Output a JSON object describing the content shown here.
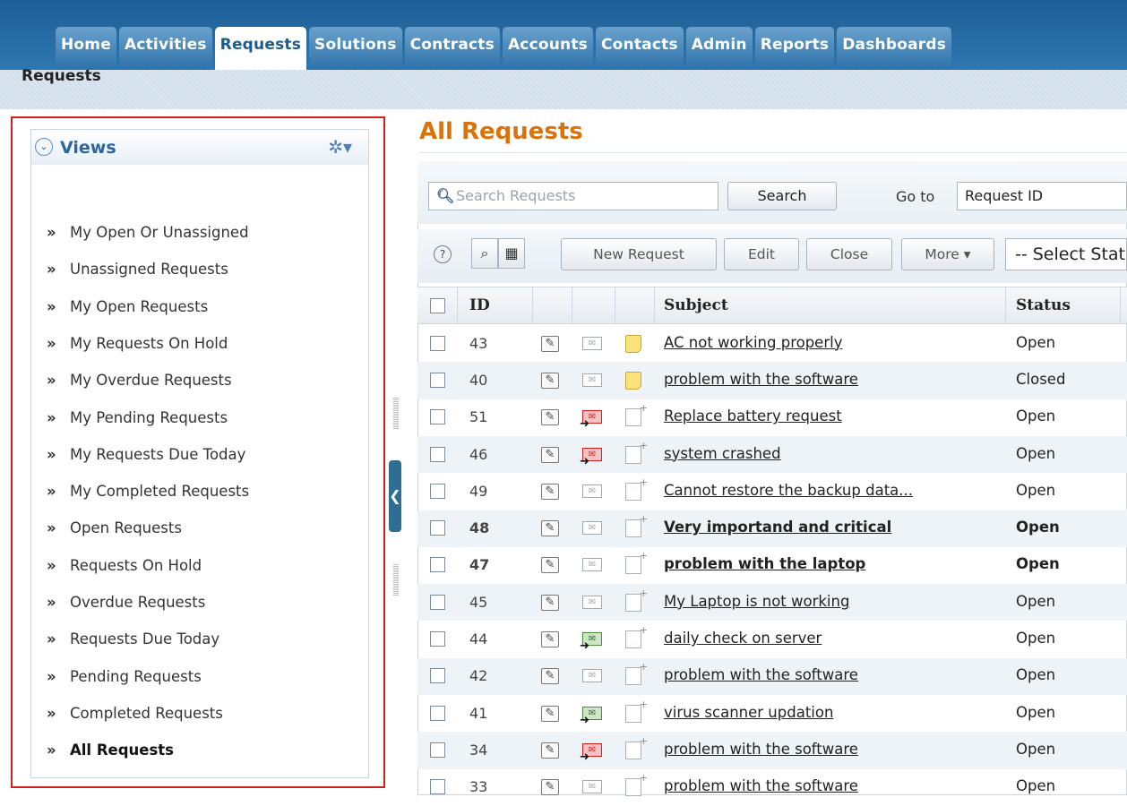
{
  "tabs": [
    {
      "label": "Home"
    },
    {
      "label": "Activities"
    },
    {
      "label": "Requests"
    },
    {
      "label": "Solutions"
    },
    {
      "label": "Contracts"
    },
    {
      "label": "Accounts"
    },
    {
      "label": "Contacts"
    },
    {
      "label": "Admin"
    },
    {
      "label": "Reports"
    },
    {
      "label": "Dashboards"
    }
  ],
  "active_tab": "Requests",
  "sidebar": {
    "header": "Views",
    "section": "Requests",
    "items": [
      {
        "label": "My Open Or Unassigned"
      },
      {
        "label": "Unassigned Requests"
      },
      {
        "label": "My Open Requests"
      },
      {
        "label": "My Requests On Hold"
      },
      {
        "label": "My Overdue Requests"
      },
      {
        "label": "My Pending Requests"
      },
      {
        "label": "My Requests Due Today"
      },
      {
        "label": "My Completed Requests"
      },
      {
        "label": "Open Requests"
      },
      {
        "label": "Requests On Hold"
      },
      {
        "label": "Overdue Requests"
      },
      {
        "label": "Requests Due Today"
      },
      {
        "label": "Pending Requests"
      },
      {
        "label": "Completed Requests"
      },
      {
        "label": "All Requests"
      }
    ],
    "bullet": "»"
  },
  "main": {
    "title": "All Requests",
    "search": {
      "placeholder": "Search Requests",
      "button": "Search",
      "goto_label": "Go to",
      "goto_value": "Request ID"
    },
    "toolbar": {
      "help": "?",
      "new_request": "New Request",
      "edit": "Edit",
      "close": "Close",
      "more": "More",
      "filter": "-- Select Status --"
    },
    "columns": {
      "id": "ID",
      "subject": "Subject",
      "status": "Status"
    },
    "rows": [
      {
        "id": "43",
        "subject": "AC not working properly",
        "status": "Open",
        "mail": "plain",
        "note": "yellow"
      },
      {
        "id": "40",
        "subject": "problem with the software",
        "status": "Closed",
        "mail": "plain",
        "note": "yellow"
      },
      {
        "id": "51",
        "subject": "Replace battery request",
        "status": "Open",
        "mail": "red",
        "note": "blank"
      },
      {
        "id": "46",
        "subject": "system crashed",
        "status": "Open",
        "mail": "red",
        "note": "blank"
      },
      {
        "id": "49",
        "subject": "Cannot restore the backup data...",
        "status": "Open",
        "mail": "plain",
        "note": "blank"
      },
      {
        "id": "48",
        "subject": "Very importand and critical",
        "status": "Open",
        "mail": "plain",
        "note": "blank"
      },
      {
        "id": "47",
        "subject": "problem with the laptop",
        "status": "Open",
        "mail": "plain",
        "note": "blank"
      },
      {
        "id": "45",
        "subject": "My Laptop is not working",
        "status": "Open",
        "mail": "plain",
        "note": "blank"
      },
      {
        "id": "44",
        "subject": "daily check on server",
        "status": "Open",
        "mail": "green",
        "note": "blank"
      },
      {
        "id": "42",
        "subject": "problem with the software",
        "status": "Open",
        "mail": "plain",
        "note": "blank"
      },
      {
        "id": "41",
        "subject": "virus scanner updation",
        "status": "Open",
        "mail": "green",
        "note": "blank"
      },
      {
        "id": "34",
        "subject": "problem with the software",
        "status": "Open",
        "mail": "red",
        "note": "blank"
      },
      {
        "id": "33",
        "subject": "problem with the software",
        "status": "Open",
        "mail": "plain",
        "note": "blank"
      }
    ],
    "bold_rows": [
      "48",
      "47"
    ]
  },
  "colors": {
    "brand": "#2f77b0",
    "title_orange": "#d8740b",
    "highlight_border": "#d11e1e",
    "views_blue": "#2a66a0"
  },
  "icons": [
    "chevron-down-icon",
    "gear-icon",
    "search-icon",
    "help-icon",
    "columns-icon",
    "edit-icon",
    "mail-icon",
    "note-icon",
    "collapse-arrow-icon"
  ]
}
